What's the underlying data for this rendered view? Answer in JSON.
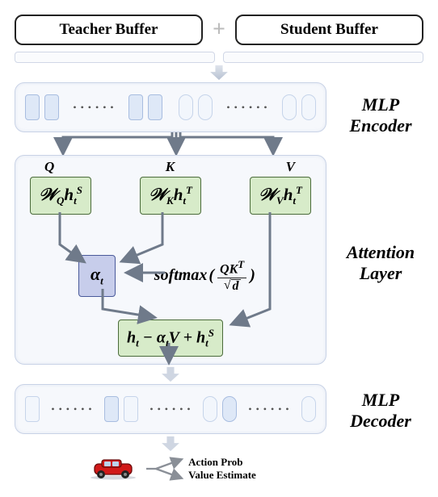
{
  "buffers": {
    "teacher": "Teacher Buffer",
    "student": "Student Buffer"
  },
  "side_labels": {
    "encoder": "MLP\nEncoder",
    "attention": "Attention\nLayer",
    "decoder": "MLP\nDecoder"
  },
  "qkv": {
    "q_label": "Q",
    "k_label": "K",
    "v_label": "V",
    "q_box": {
      "W": "𝒲",
      "sub": "Q",
      "h": "h",
      "t": "t",
      "sup": "S"
    },
    "k_box": {
      "W": "𝒲",
      "sub": "K",
      "h": "h",
      "t": "t",
      "sup": "T"
    },
    "v_box": {
      "W": "𝒲",
      "sub": "V",
      "h": "h",
      "t": "t",
      "sup": "T"
    }
  },
  "alpha": {
    "sym": "α",
    "t": "t"
  },
  "softmax": {
    "fn": "softmax",
    "num1": "Q",
    "num2": "K",
    "num_sup": "T",
    "den_sym": "d"
  },
  "combine": {
    "h": "h",
    "t": "t",
    "minus": " − ",
    "alpha": "α",
    "V": "V",
    "plus": " + ",
    "sup": "S"
  },
  "outputs": {
    "action": "Action Prob",
    "value": "Value Estimate"
  },
  "colors": {
    "arrow": "#6f7a8a",
    "green": "#d7ebc9",
    "blue": "#c7cdeb"
  }
}
